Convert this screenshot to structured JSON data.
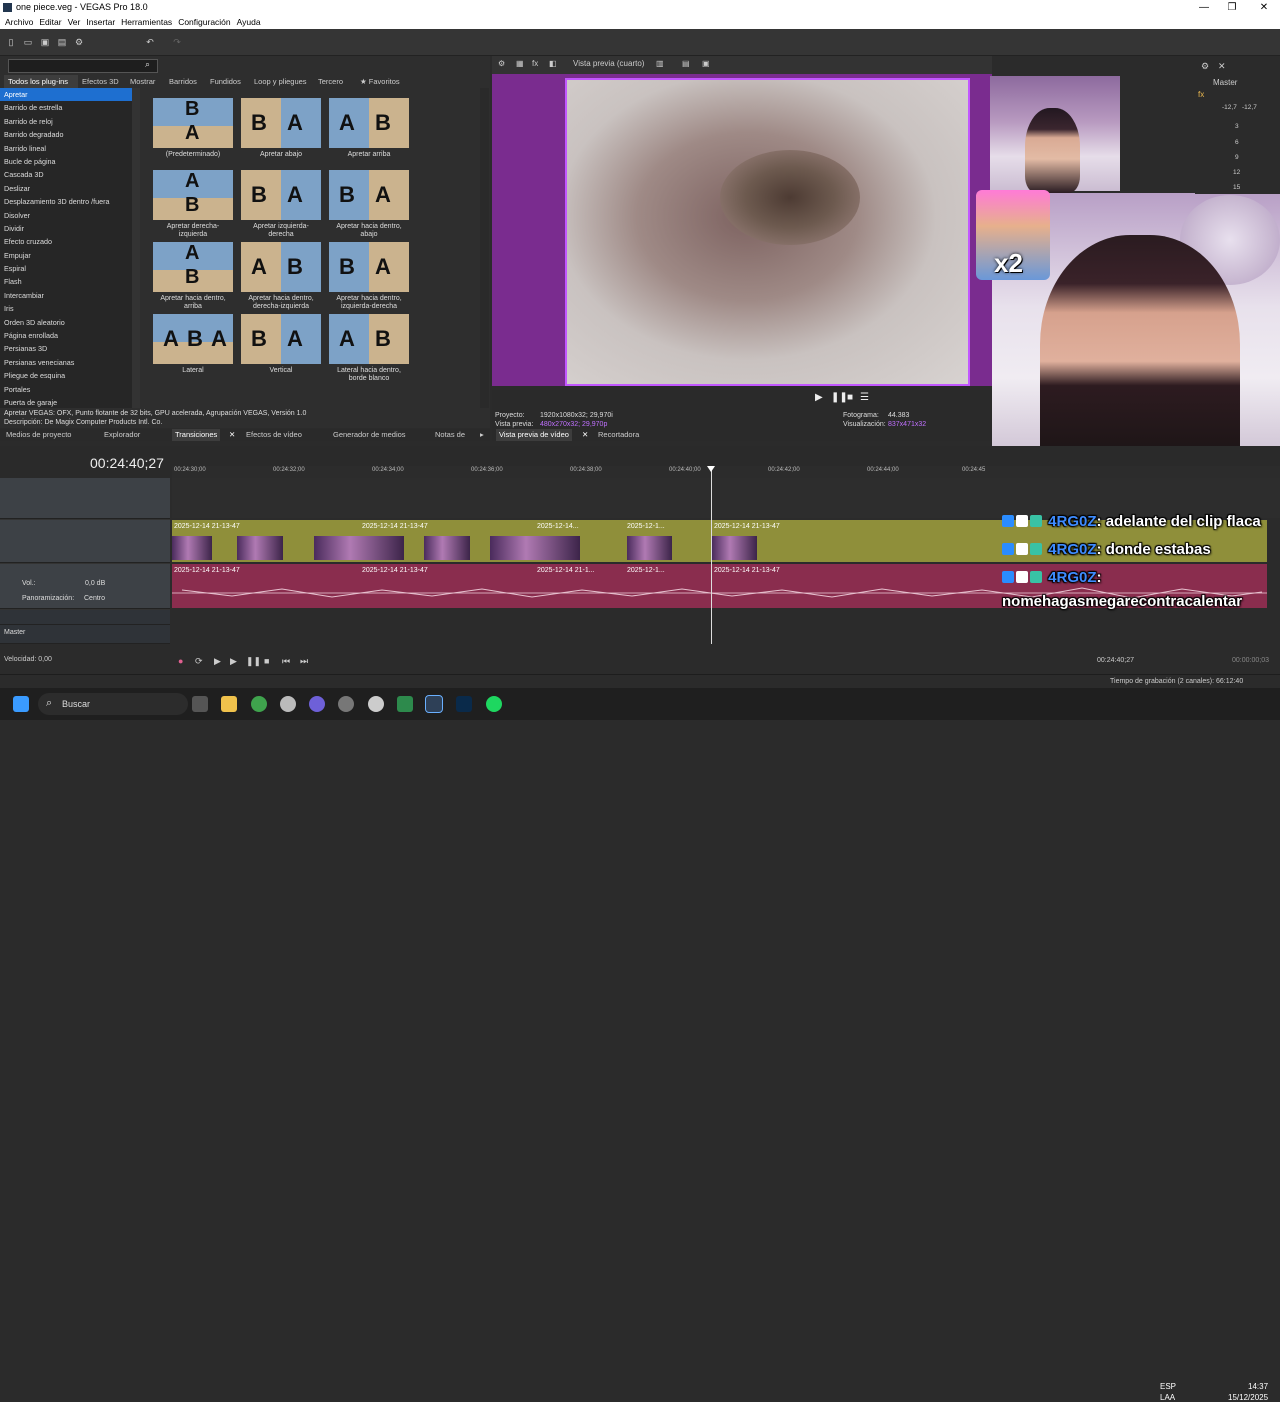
{
  "window": {
    "title": "one piece.veg - VEGAS Pro 18.0",
    "minimize": "—",
    "maximize": "❐",
    "close": "✕"
  },
  "menu": [
    "Archivo",
    "Editar",
    "Ver",
    "Insertar",
    "Herramientas",
    "Configuración",
    "Ayuda"
  ],
  "fx_panel": {
    "tabs": [
      "Todos los plug-ins",
      "Efectos 3D",
      "Mostrar",
      "Barridos",
      "Fundidos",
      "Loop y pliegues",
      "Tercero",
      "★ Favoritos"
    ],
    "plugins": [
      "Apretar",
      "Barrido de estrella",
      "Barrido de reloj",
      "Barrido degradado",
      "Barrido lineal",
      "Bucle de página",
      "Cascada 3D",
      "Deslizar",
      "Desplazamiento 3D dentro /fuera",
      "Disolver",
      "Dividir",
      "Efecto cruzado",
      "Empujar",
      "Espiral",
      "Flash",
      "Intercambiar",
      "Iris",
      "Orden 3D aleatorio",
      "Página enrollada",
      "Persianas 3D",
      "Persianas venecianas",
      "Pliegue de esquina",
      "Portales",
      "Puerta de garaje"
    ],
    "presets": [
      {
        "label": "(Predeterminado)",
        "letters": "B A"
      },
      {
        "label": "Apretar abajo",
        "letters": "B A"
      },
      {
        "label": "Apretar arriba",
        "letters": "A B"
      },
      {
        "label": "Apretar derecha-izquierda",
        "letters": "A B"
      },
      {
        "label": "Apretar izquierda-derecha",
        "letters": "B A"
      },
      {
        "label": "Apretar hacia dentro, abajo",
        "letters": "B A"
      },
      {
        "label": "Apretar hacia dentro, arriba",
        "letters": "A B"
      },
      {
        "label": "Apretar hacia dentro, derecha-izquierda",
        "letters": "A B"
      },
      {
        "label": "Apretar hacia dentro, izquierda-derecha",
        "letters": "B A"
      },
      {
        "label": "Lateral",
        "letters": "A B A"
      },
      {
        "label": "Vertical",
        "letters": "B A"
      },
      {
        "label": "Lateral hacia dentro, borde blanco",
        "letters": "A B"
      }
    ],
    "info_line1": "Apretar VEGAS: OFX, Punto flotante de 32 bits, GPU acelerada, Agrupación VEGAS, Versión 1.0",
    "info_line2": "Descripción: De Magix Computer Products Intl. Co.",
    "bottom_tabs": [
      "Medios de proyecto",
      "Explorador",
      "Transiciones",
      "Efectos de vídeo",
      "Generador de medios",
      "Notas de"
    ]
  },
  "preview": {
    "quality": "Vista previa (cuarto)",
    "proyecto_label": "Proyecto:",
    "proyecto_value": "1920x1080x32; 29,970i",
    "vista_label": "Vista previa:",
    "vista_value": "480x270x32; 29,970p",
    "fotograma_label": "Fotograma:",
    "fotograma_value": "44.383",
    "visualizacion_label": "Visualización:",
    "visualizacion_value": "837x471x32",
    "tabs": [
      "Vista previa de vídeo",
      "Recortadora"
    ],
    "sticker_text": "x2"
  },
  "master": {
    "label": "Master",
    "levels": [
      "-12,7",
      "-12,7"
    ],
    "scale": [
      "3",
      "6",
      "9",
      "12",
      "15"
    ]
  },
  "timeline": {
    "timecode": "00:24:40;27",
    "ruler": [
      "00:24:30;00",
      "00:24:32;00",
      "00:24:34;00",
      "00:24:36;00",
      "00:24:38;00",
      "00:24:40;00",
      "00:24:42;00",
      "00:24:44;00",
      "00:24:45"
    ],
    "video_clips": [
      "2025-12-14 21-13-47",
      "2025-12-14 21-13-47",
      "2025-12-14...",
      "2025-12-1...",
      "2025-12-14 21-13-47"
    ],
    "audio_clips": [
      "2025-12-14 21-13-47",
      "2025-12-14 21-13-47",
      "2025-12-14 21-1...",
      "2025-12-1...",
      "2025-12-14 21-13-47"
    ],
    "vol_label": "Vol.:",
    "vol_value": "0,0 dB",
    "pan_label": "Panoramización:",
    "pan_value": "Centro",
    "master_label": "Master",
    "velocidad": "Velocidad: 0,00",
    "end_time": "00:24:40;27",
    "end_time2": "00:00:00;03",
    "status": "Tiempo de grabación (2 canales): 66:12:40"
  },
  "chat": [
    {
      "user": "4RG0Z",
      "msg": ": adelante del clip flaca"
    },
    {
      "user": "4RG0Z",
      "msg": ": donde estabas"
    },
    {
      "user": "4RG0Z",
      "msg": ":"
    },
    {
      "user": "",
      "msg": "nomehagasmegarecontracalentar"
    }
  ],
  "taskbar": {
    "search": "Buscar",
    "lang1": "ESP",
    "lang2": "LAA",
    "time": "14:37",
    "date": "15/12/2025"
  },
  "colors": {
    "accent": "#1e6fd0",
    "video_track": "#8f8f3a",
    "audio_track": "#8a2d4e",
    "chat_user": "#3e8cff"
  }
}
